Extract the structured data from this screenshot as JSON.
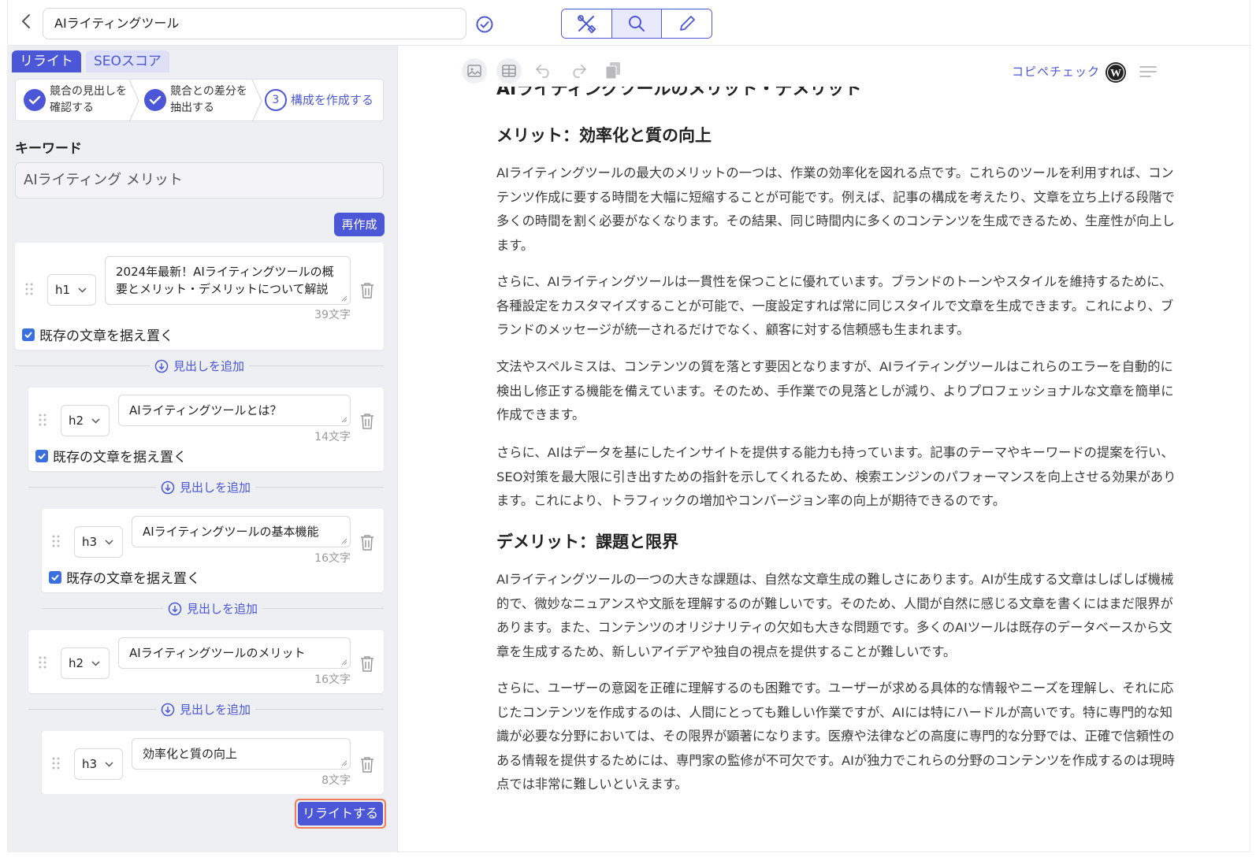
{
  "topbar": {
    "title_value": "AIライティングツール",
    "icons": [
      "back-arrow-icon",
      "check-circle-icon",
      "tools-icon",
      "search-icon",
      "pencil-icon"
    ]
  },
  "left": {
    "tabs": [
      {
        "label": "リライト"
      },
      {
        "label": "SEOスコア"
      }
    ],
    "steps": [
      {
        "label_line1": "競合の見出しを",
        "label_line2": "確認する"
      },
      {
        "label_line1": "競合との差分を",
        "label_line2": "抽出する"
      },
      {
        "number": "3",
        "label": "構成を作成する"
      }
    ],
    "keyword_label": "キーワード",
    "keyword_value": "AIライティング メリット",
    "regen_label": "再作成",
    "keep_label": "既存の文章を据え置く",
    "add_heading_label": "見出しを追加",
    "headings": [
      {
        "level": "h1",
        "text": "2024年最新！AIライティングツールの概要とメリット・デメリットについて解説",
        "count": "39文字"
      },
      {
        "level": "h2",
        "text": "AIライティングツールとは？",
        "count": "14文字"
      },
      {
        "level": "h3",
        "text": "AIライティングツールの基本機能",
        "count": "16文字"
      },
      {
        "level": "h2",
        "text": "AIライティングツールのメリット",
        "count": "16文字"
      },
      {
        "level": "h3",
        "text": "効率化と質の向上",
        "count": "8文字"
      }
    ],
    "rewrite_label": "リライトする"
  },
  "right": {
    "copipe_label": "コピペチェック",
    "cut_heading": "AIライティングツールのメリット・デメリット",
    "h_merit": "メリット：効率化と質の向上",
    "p1": "AIライティングツールの最大のメリットの一つは、作業の効率化を図れる点です。これらのツールを利用すれば、コンテンツ作成に要する時間を大幅に短縮することが可能です。例えば、記事の構成を考えたり、文章を立ち上げる段階で多くの時間を割く必要がなくなります。その結果、同じ時間内に多くのコンテンツを生成できるため、生産性が向上します。",
    "p2": "さらに、AIライティングツールは一貫性を保つことに優れています。ブランドのトーンやスタイルを維持するために、各種設定をカスタマイズすることが可能で、一度設定すれば常に同じスタイルで文章を生成できます。これにより、ブランドのメッセージが統一されるだけでなく、顧客に対する信頼感も生まれます。",
    "p3": "文法やスペルミスは、コンテンツの質を落とす要因となりますが、AIライティングツールはこれらのエラーを自動的に検出し修正する機能を備えています。そのため、手作業での見落としが減り、よりプロフェッショナルな文章を簡単に作成できます。",
    "p4": "さらに、AIはデータを基にしたインサイトを提供する能力も持っています。記事のテーマやキーワードの提案を行い、SEO対策を最大限に引き出すための指針を示してくれるため、検索エンジンのパフォーマンスを向上させる効果があります。これにより、トラフィックの増加やコンバージョン率の向上が期待できるのです。",
    "h_demerit": "デメリット：課題と限界",
    "p5": "AIライティングツールの一つの大きな課題は、自然な文章生成の難しさにあります。AIが生成する文章はしばしば機械的で、微妙なニュアンスや文脈を理解するのが難しいです。そのため、人間が自然に感じる文章を書くにはまだ限界があります。また、コンテンツのオリジナリティの欠如も大きな問題です。多くのAIツールは既存のデータベースから文章を生成するため、新しいアイデアや独自の視点を提供することが難しいです。",
    "p6": "さらに、ユーザーの意図を正確に理解するのも困難です。ユーザーが求める具体的な情報やニーズを理解し、それに応じたコンテンツを作成するのは、人間にとっても難しい作業ですが、AIには特にハードルが高いです。特に専門的な知識が必要な分野においては、その限界が顕著になります。医療や法律などの高度に専門的な分野では、正確で信頼性のある情報を提供するためには、専門家の監修が不可欠です。AIが独力でこれらの分野のコンテンツを作成するのは現時点では非常に難しいといえます。"
  },
  "colors": {
    "accent": "#4b57d6",
    "checkbox": "#3a6fe0",
    "highlight_border": "#f07b5b"
  }
}
